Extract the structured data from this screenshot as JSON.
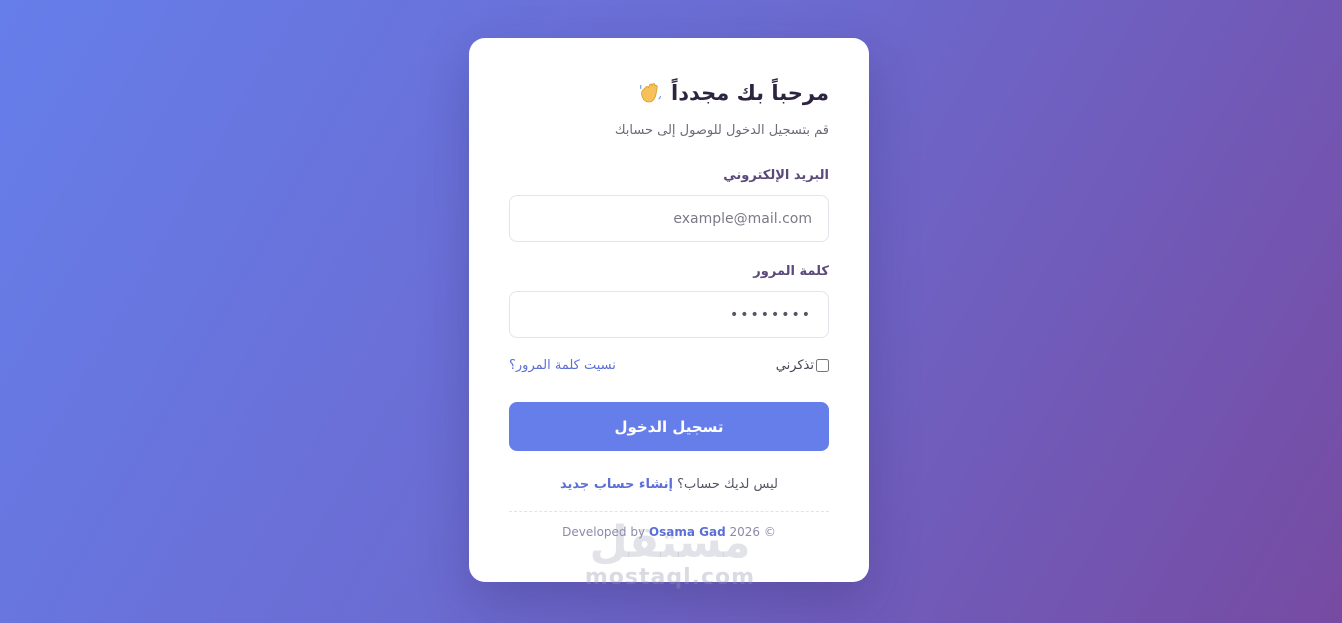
{
  "header": {
    "title": "مرحباً بك مجدداً",
    "wave_icon": "waving-hand-icon",
    "subtitle": "قم بتسجيل الدخول للوصول إلى حسابك"
  },
  "form": {
    "email_label": "البريد الإلكتروني",
    "email_placeholder": "example@mail.com",
    "password_label": "كلمة المرور",
    "password_value": "password",
    "remember_label": "تذكرني",
    "remember_checked": false,
    "forgot_link": "نسيت كلمة المرور؟",
    "submit_label": "تسجيل الدخول"
  },
  "signup": {
    "prompt": "ليس لديك حساب؟",
    "link": "إنشاء حساب جديد"
  },
  "footer": {
    "developed_by": "Developed by",
    "author": "Osama Gad",
    "year": "2026 ©"
  },
  "watermark": {
    "arabic": "مستقل",
    "domain": "mostaql.com"
  },
  "colors": {
    "accent": "#667eea",
    "gradient_start": "#667eea",
    "gradient_end": "#764ba2",
    "link": "#5b6fd6"
  }
}
